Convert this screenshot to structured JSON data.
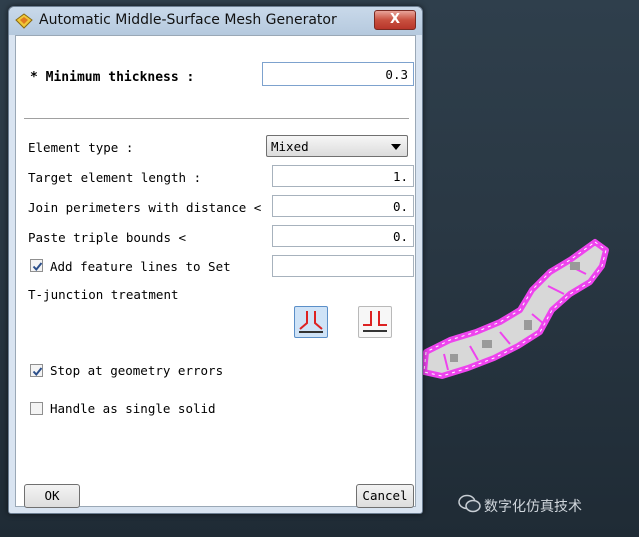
{
  "window": {
    "title": "Automatic Middle-Surface Mesh Generator",
    "close_label": "X"
  },
  "form": {
    "min_thickness": {
      "label": "* Minimum thickness :",
      "value": "0.3"
    },
    "element_type": {
      "label": "Element type :",
      "selected": "Mixed"
    },
    "target_length": {
      "label": "Target element length :",
      "value": "1."
    },
    "join_perimeters": {
      "label": "Join perimeters with distance <",
      "value": "0."
    },
    "paste_triple": {
      "label": "Paste triple bounds <",
      "value": "0."
    },
    "feature_lines": {
      "label": "Add feature lines to Set",
      "checked": true,
      "value": ""
    },
    "tjunction": {
      "label": "T-junction treatment",
      "selected_option": 0
    },
    "stop_errors": {
      "label": "Stop at geometry errors",
      "checked": true
    },
    "single_solid": {
      "label": "Handle as single solid",
      "checked": false
    }
  },
  "buttons": {
    "ok": "OK",
    "cancel": "Cancel"
  },
  "watermark": {
    "text": "数字化仿真技术"
  },
  "colors": {
    "mesh_edge": "#ee44ee",
    "mesh_face": "#d6d6d6",
    "accent": "#5b8fc8"
  }
}
